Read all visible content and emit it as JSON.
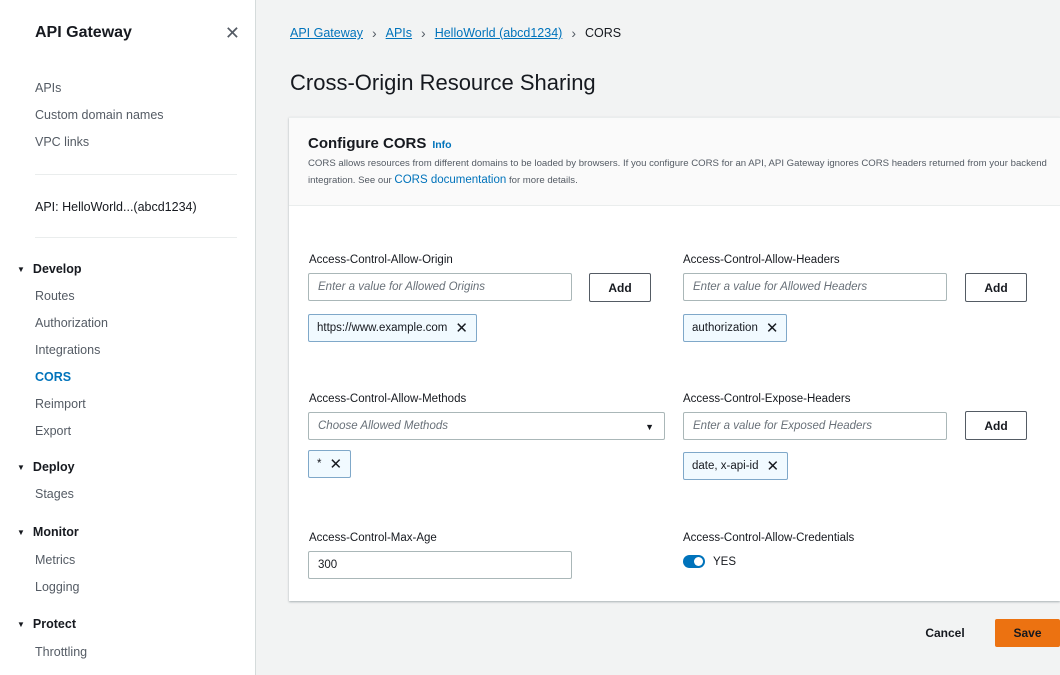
{
  "sidebar": {
    "title": "API Gateway",
    "close_icon": "close-icon",
    "top_links": [
      "APIs",
      "Custom domain names",
      "VPC links"
    ],
    "api_label": "API: HelloWorld...(abcd1234)",
    "sections": [
      {
        "label": "Develop",
        "items": [
          "Routes",
          "Authorization",
          "Integrations",
          "CORS",
          "Reimport",
          "Export"
        ]
      },
      {
        "label": "Deploy",
        "items": [
          "Stages"
        ]
      },
      {
        "label": "Monitor",
        "items": [
          "Metrics",
          "Logging"
        ]
      },
      {
        "label": "Protect",
        "items": [
          "Throttling"
        ]
      }
    ],
    "active_item": "CORS"
  },
  "breadcrumb": {
    "items": [
      "API Gateway",
      "APIs",
      "HelloWorld (abcd1234)"
    ],
    "current": "CORS"
  },
  "page_title": "Cross-Origin Resource Sharing",
  "panel": {
    "title": "Configure CORS",
    "info_link": "Info",
    "description_pre": "CORS allows resources from different domains to be loaded by browsers. If you configure CORS for an API, API Gateway ignores CORS headers returned from your backend integration. See our ",
    "description_link": "CORS documentation",
    "description_post": " for more details."
  },
  "fields": {
    "allow_origin": {
      "label": "Access-Control-Allow-Origin",
      "placeholder": "Enter a value for Allowed Origins",
      "add_label": "Add",
      "token": "https://www.example.com"
    },
    "allow_headers": {
      "label": "Access-Control-Allow-Headers",
      "placeholder": "Enter a value for Allowed Headers",
      "add_label": "Add",
      "token": "authorization"
    },
    "allow_methods": {
      "label": "Access-Control-Allow-Methods",
      "placeholder": "Choose Allowed Methods",
      "token": "*"
    },
    "expose_headers": {
      "label": "Access-Control-Expose-Headers",
      "placeholder": "Enter a value for Exposed Headers",
      "add_label": "Add",
      "token": "date, x-api-id"
    },
    "max_age": {
      "label": "Access-Control-Max-Age",
      "value": "300"
    },
    "allow_credentials": {
      "label": "Access-Control-Allow-Credentials",
      "value_label": "YES",
      "enabled": true
    }
  },
  "actions": {
    "cancel": "Cancel",
    "save": "Save"
  },
  "colors": {
    "link": "#0073bb",
    "primary_button": "#ec7211",
    "token_bg": "#f1faff"
  }
}
